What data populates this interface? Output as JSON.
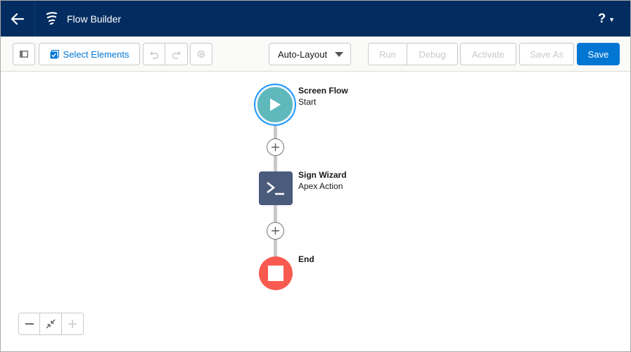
{
  "header": {
    "title": "Flow Builder",
    "help_label": "?"
  },
  "toolbar": {
    "select_elements_label": "Select Elements",
    "layout_selected": "Auto-Layout",
    "run_label": "Run",
    "debug_label": "Debug",
    "activate_label": "Activate",
    "save_as_label": "Save As",
    "save_label": "Save"
  },
  "canvas": {
    "start": {
      "title": "Screen Flow",
      "subtitle": "Start"
    },
    "action": {
      "title": "Sign Wizard",
      "subtitle": "Apex Action"
    },
    "end": {
      "title": "End"
    }
  },
  "icons": {
    "back": "back-arrow-icon",
    "logo": "flow-logo-icon",
    "toggle_panel": "toggle-panel-icon",
    "select_elements": "checkbox-icon",
    "undo": "undo-icon",
    "redo": "redo-icon",
    "settings": "gear-icon",
    "start": "play-icon",
    "apex": "terminal-icon",
    "end": "stop-icon",
    "zoom_out": "minus-icon",
    "fit": "shrink-icon",
    "zoom_in": "plus-icon"
  },
  "colors": {
    "header_bg": "#032d60",
    "brand_blue": "#0176d3",
    "start_node": "#5fb8bc",
    "apex_node": "#4a5b7c",
    "end_node": "#f95a50"
  }
}
